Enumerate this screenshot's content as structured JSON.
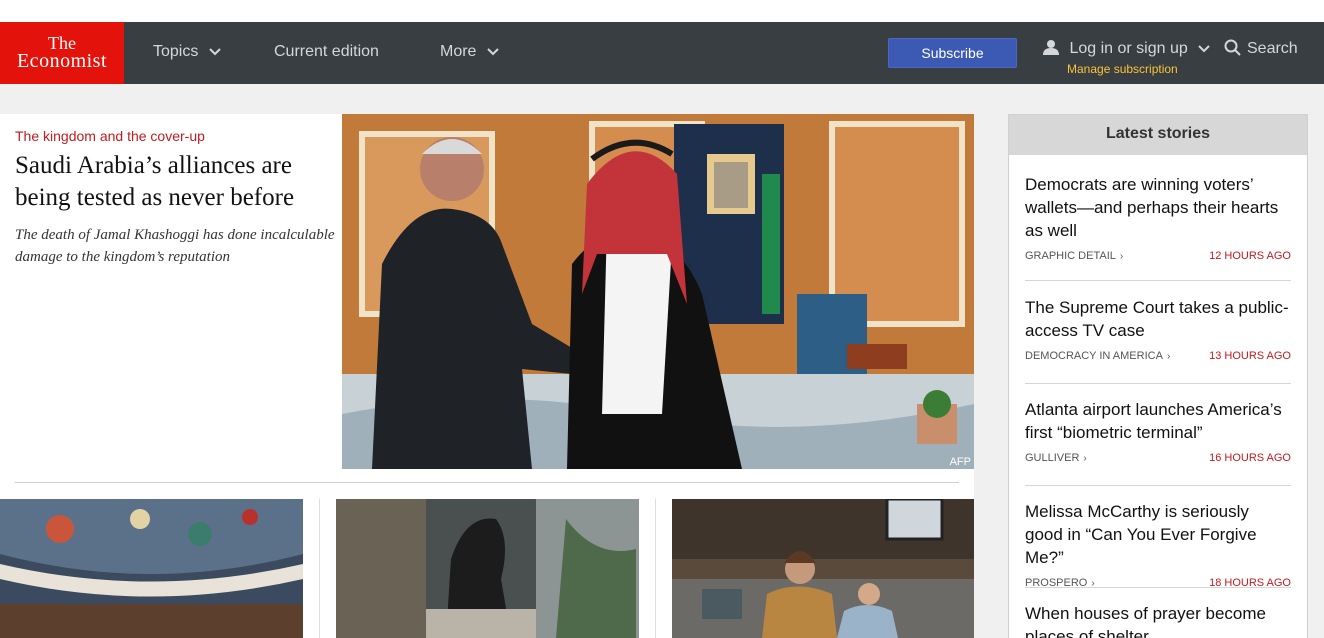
{
  "logo": {
    "line1": "The",
    "line2": "Economist"
  },
  "nav": {
    "topics": "Topics",
    "current_edition": "Current edition",
    "more": "More",
    "subscribe": "Subscribe",
    "login": "Log in or sign up",
    "manage": "Manage subscription",
    "search": "Search"
  },
  "hero": {
    "fly_title": "The kingdom and the cover-up",
    "headline": "Saudi Arabia’s alliances are being tested as never before",
    "rubric": "The death of Jamal Khashoggi has done incalculable damage to the kingdom’s reputation",
    "image_credit": "AFP"
  },
  "sidebar": {
    "title": "Latest stories",
    "items": [
      {
        "title": "Democrats are winning voters’ wallets—and perhaps their hearts as well",
        "section": "Graphic detail",
        "time": "12 hours ago"
      },
      {
        "title": "The Supreme Court takes a public-access TV case",
        "section": "Democracy in America",
        "time": "13 hours ago"
      },
      {
        "title": "Atlanta airport launches America’s first “biometric terminal”",
        "section": "Gulliver",
        "time": "16 hours ago"
      },
      {
        "title": "Melissa McCarthy is seriously good in “Can You Ever Forgive Me?”",
        "section": "Prospero",
        "time": "18 hours ago"
      },
      {
        "title": "When houses of prayer become places of shelter",
        "section": "",
        "time": ""
      }
    ]
  },
  "colors": {
    "brand_red": "#e3120b",
    "nav_bg": "#383e42",
    "subscribe_blue": "#3c5ab4",
    "accent_yellow": "#f9c43a",
    "time_red": "#c01b20"
  }
}
